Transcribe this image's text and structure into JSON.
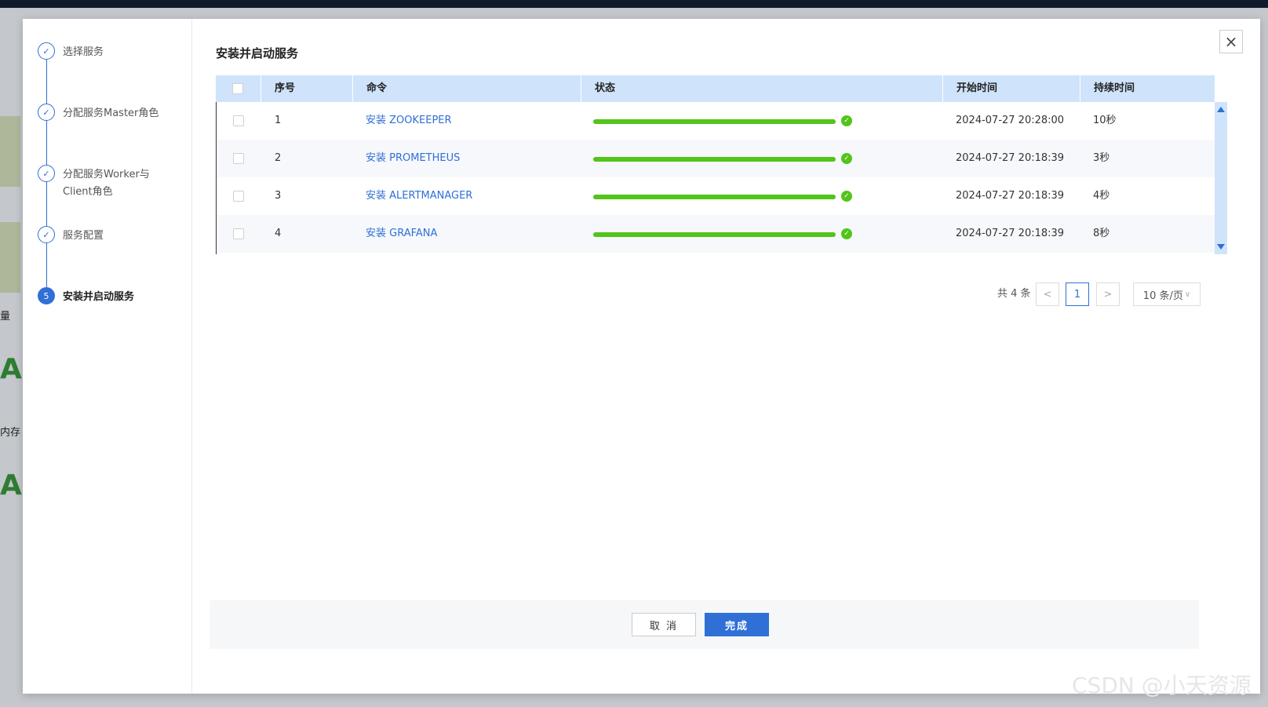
{
  "background": {
    "label_1": "量",
    "label_2": "内存",
    "big_1": "A",
    "big_2": "A"
  },
  "steps": [
    {
      "label": "选择服务",
      "status": "done"
    },
    {
      "label": "分配服务Master角色",
      "status": "done"
    },
    {
      "label": "分配服务Worker与Client角色",
      "status": "done"
    },
    {
      "label": "服务配置",
      "status": "done"
    },
    {
      "label": "安装并启动服务",
      "status": "active",
      "number": "5"
    }
  ],
  "dialog": {
    "title": "安装并启动服务",
    "close_icon": "×"
  },
  "table": {
    "headers": [
      "序号",
      "命令",
      "状态",
      "开始时间",
      "持续时间"
    ],
    "rows": [
      {
        "index": "1",
        "command": "安装 ZOOKEEPER",
        "progress": 100,
        "start": "2024-07-27 20:28:00",
        "duration": "10秒"
      },
      {
        "index": "2",
        "command": "安装 PROMETHEUS",
        "progress": 100,
        "start": "2024-07-27 20:18:39",
        "duration": "3秒"
      },
      {
        "index": "3",
        "command": "安装 ALERTMANAGER",
        "progress": 100,
        "start": "2024-07-27 20:18:39",
        "duration": "4秒"
      },
      {
        "index": "4",
        "command": "安装 GRAFANA",
        "progress": 100,
        "start": "2024-07-27 20:18:39",
        "duration": "8秒"
      }
    ]
  },
  "pagination": {
    "total": "共 4 条",
    "prev": "<",
    "current": "1",
    "next": ">",
    "page_size": "10 条/页"
  },
  "footer": {
    "cancel_label": "取 消",
    "ok_label": "完成"
  },
  "colors": {
    "primary": "#2f6fd6",
    "success": "#52c41a",
    "header_bg": "#cfe3fb"
  },
  "watermark": "CSDN @小天资源"
}
